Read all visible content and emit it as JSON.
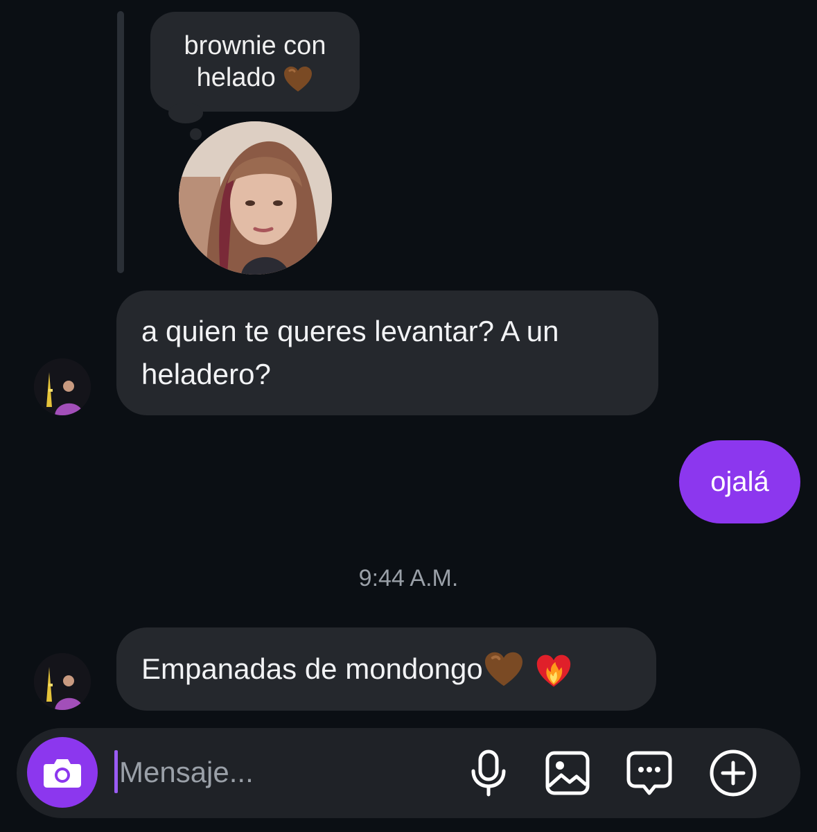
{
  "thread": {
    "note": {
      "text": "brownie con helado",
      "emoji_icon": "brown-heart-icon"
    },
    "messages": [
      {
        "direction": "incoming",
        "text": "a quien te queres levantar? A un heladero?"
      },
      {
        "direction": "outgoing",
        "text": "ojalá"
      },
      {
        "direction": "incoming",
        "text": "Empanadas de mondongo",
        "emoji_icons": [
          "brown-heart-icon",
          "heart-on-fire-icon"
        ]
      }
    ],
    "timestamp": "9:44 A.M."
  },
  "composer": {
    "placeholder": "Mensaje...",
    "icons": [
      "camera-icon",
      "microphone-icon",
      "image-icon",
      "sticker-chat-icon",
      "add-circle-icon"
    ]
  },
  "colors": {
    "background": "#0b0f14",
    "incoming_bubble": "#25282d",
    "outgoing_bubble": "#8c37ee",
    "accent": "#8c37ee",
    "brown_heart": "#7a4a24"
  }
}
